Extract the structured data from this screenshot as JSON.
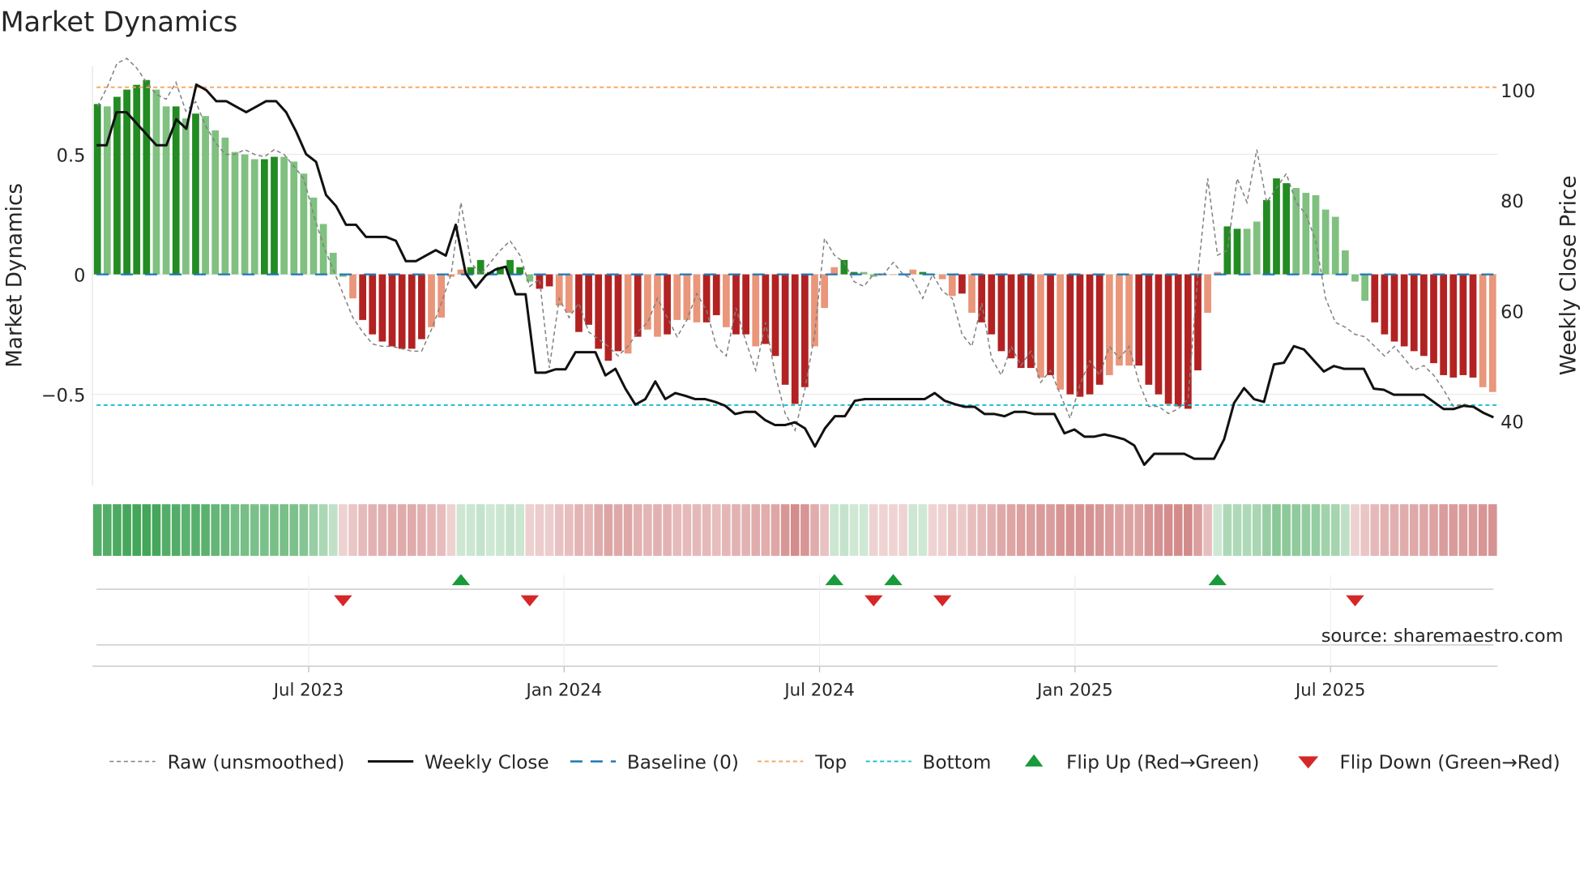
{
  "chart_data": {
    "type": "bar",
    "title": "Market Dynamics",
    "ylabel": "Market Dynamics",
    "y2label": "Weekly Close Price",
    "ylim": [
      -0.88,
      0.88
    ],
    "y2lim": [
      28,
      104.6
    ],
    "yticks": [
      {
        "v": 0.5,
        "label": "0.5"
      },
      {
        "v": 0,
        "label": "0"
      },
      {
        "v": -0.5,
        "label": "−0.5"
      }
    ],
    "y2ticks": [
      {
        "v": 100,
        "label": "100"
      },
      {
        "v": 80,
        "label": "80"
      },
      {
        "v": 60,
        "label": "60"
      },
      {
        "v": 40,
        "label": "40"
      }
    ],
    "xticks": [
      {
        "week": 22,
        "label": "Jul 2023"
      },
      {
        "week": 48,
        "label": "Jan 2024"
      },
      {
        "week": 74,
        "label": "Jul 2024"
      },
      {
        "week": 100,
        "label": "Jan 2025"
      },
      {
        "week": 126,
        "label": "Jul 2025"
      }
    ],
    "top": 0.78,
    "bottom": -0.545,
    "baseline": 0,
    "colors": {
      "G": "#228b22",
      "g": "#80c080",
      "R": "#b22222",
      "r": "#e9967a",
      "raw": "#808080",
      "close": "#111111",
      "baseline": "#1f77b4",
      "top": "#f4a460",
      "bottom": "#17becf",
      "flip_up": "#1a9a3a",
      "flip_down": "#d62728"
    },
    "bars": [
      0.71,
      0.7,
      0.74,
      0.77,
      0.79,
      0.81,
      0.77,
      0.7,
      0.7,
      0.65,
      0.67,
      0.66,
      0.6,
      0.57,
      0.51,
      0.5,
      0.48,
      0.48,
      0.49,
      0.49,
      0.47,
      0.42,
      0.32,
      0.21,
      0.09,
      -0.01,
      -0.1,
      -0.19,
      -0.25,
      -0.28,
      -0.3,
      -0.31,
      -0.31,
      -0.27,
      -0.22,
      -0.18,
      -0.01,
      0.02,
      0.03,
      0.06,
      0.01,
      0.03,
      0.06,
      0.03,
      -0.03,
      -0.06,
      -0.05,
      -0.13,
      -0.16,
      -0.24,
      -0.21,
      -0.31,
      -0.36,
      -0.32,
      -0.33,
      -0.26,
      -0.23,
      -0.26,
      -0.25,
      -0.19,
      -0.19,
      -0.2,
      -0.2,
      -0.17,
      -0.22,
      -0.25,
      -0.25,
      -0.3,
      -0.29,
      -0.34,
      -0.46,
      -0.54,
      -0.47,
      -0.3,
      -0.14,
      0.03,
      0.06,
      0.01,
      0.01,
      -0.01,
      0.0,
      0.0,
      0.0,
      0.02,
      0.01,
      0.0,
      -0.02,
      -0.09,
      -0.08,
      -0.16,
      -0.2,
      -0.25,
      -0.32,
      -0.35,
      -0.39,
      -0.39,
      -0.43,
      -0.42,
      -0.48,
      -0.5,
      -0.51,
      -0.5,
      -0.46,
      -0.42,
      -0.38,
      -0.38,
      -0.38,
      -0.46,
      -0.5,
      -0.54,
      -0.55,
      -0.56,
      -0.4,
      -0.16,
      0.01,
      0.2,
      0.19,
      0.19,
      0.22,
      0.31,
      0.4,
      0.38,
      0.36,
      0.34,
      0.33,
      0.27,
      0.24,
      0.1,
      -0.03,
      -0.11,
      -0.2,
      -0.25,
      -0.28,
      -0.3,
      -0.32,
      -0.34,
      -0.37,
      -0.42,
      -0.43,
      -0.42,
      -0.43,
      -0.47,
      -0.49
    ],
    "bar_shades": "GgGGGGggGgGggggggGGgggggggrRRRRRRRrrrrGGGGGGgRRrrRRRRRrRrrRrrrRRrRRrRRRRRrrrGGggRrrrGgrrRrRRRRRRrRrRRRRrrrRRRRRRRrrGGggGGGggggggggRRRRRRRRRRRrrRRR",
    "raw": [
      0.7,
      0.78,
      0.88,
      0.9,
      0.86,
      0.8,
      0.75,
      0.73,
      0.8,
      0.68,
      0.72,
      0.62,
      0.55,
      0.5,
      0.5,
      0.52,
      0.5,
      0.49,
      0.52,
      0.5,
      0.45,
      0.4,
      0.25,
      0.12,
      0.02,
      -0.08,
      -0.18,
      -0.24,
      -0.29,
      -0.3,
      -0.3,
      -0.31,
      -0.32,
      -0.32,
      -0.23,
      -0.12,
      0.0,
      0.3,
      0.05,
      0.0,
      0.05,
      0.1,
      0.14,
      0.08,
      -0.05,
      -0.02,
      -0.39,
      -0.1,
      -0.18,
      -0.12,
      -0.24,
      -0.27,
      -0.3,
      -0.34,
      -0.3,
      -0.24,
      -0.2,
      -0.1,
      -0.18,
      -0.26,
      -0.19,
      -0.08,
      -0.15,
      -0.3,
      -0.34,
      -0.14,
      -0.28,
      -0.4,
      -0.2,
      -0.42,
      -0.58,
      -0.65,
      -0.48,
      -0.25,
      0.15,
      0.08,
      0.05,
      -0.03,
      -0.05,
      0.0,
      0.0,
      0.05,
      0.0,
      -0.02,
      -0.1,
      0.0,
      -0.07,
      -0.1,
      -0.25,
      -0.3,
      -0.12,
      -0.35,
      -0.42,
      -0.3,
      -0.38,
      -0.32,
      -0.45,
      -0.4,
      -0.5,
      -0.6,
      -0.46,
      -0.36,
      -0.42,
      -0.3,
      -0.35,
      -0.3,
      -0.45,
      -0.55,
      -0.55,
      -0.58,
      -0.56,
      -0.52,
      0.0,
      0.4,
      0.08,
      0.1,
      0.4,
      0.3,
      0.52,
      0.3,
      0.36,
      0.42,
      0.3,
      0.25,
      0.14,
      -0.1,
      -0.2,
      -0.22,
      -0.25,
      -0.26,
      -0.3,
      -0.34,
      -0.3,
      -0.35,
      -0.4,
      -0.38,
      -0.42,
      -0.48,
      -0.55,
      -0.54,
      -0.55
    ],
    "close": [
      90,
      90,
      96,
      96,
      94,
      92,
      90,
      90,
      94.7,
      93,
      101,
      100,
      98,
      98,
      97,
      96,
      97,
      98,
      98,
      96,
      92.5,
      88.4,
      87,
      81,
      79,
      75.6,
      75.6,
      73.4,
      73.4,
      73.4,
      72.7,
      69,
      69,
      70,
      71,
      70,
      75.6,
      66.8,
      64.2,
      66.4,
      67.5,
      68,
      63,
      63,
      48.8,
      48.8,
      49.4,
      49.4,
      52.5,
      52.5,
      52.5,
      48.3,
      49.5,
      45.9,
      43,
      44,
      47.2,
      44,
      45.1,
      44.6,
      44,
      44,
      43.5,
      42.8,
      41.3,
      41.7,
      41.7,
      40.2,
      39.3,
      39.3,
      39.8,
      38.7,
      35.4,
      38.7,
      40.9,
      40.9,
      43.7,
      44,
      44,
      44,
      44,
      44,
      44,
      44,
      45.1,
      43.7,
      43.1,
      42.6,
      42.6,
      41.3,
      41.3,
      40.9,
      41.7,
      41.7,
      41.3,
      41.3,
      41.3,
      37.8,
      38.5,
      37.2,
      37.2,
      37.6,
      37.2,
      36.7,
      35.6,
      32.1,
      34.1,
      34.1,
      34.1,
      34.1,
      33.2,
      33.2,
      33.2,
      36.7,
      43.3,
      46,
      44,
      43.5,
      50.3,
      50.6,
      53.6,
      53,
      51,
      49,
      50,
      49.5,
      49.5,
      49.5,
      45.9,
      45.7,
      44.8,
      44.8,
      44.8,
      44.8,
      43.5,
      42.2,
      42.2,
      42.8,
      42.6,
      41.5,
      40.7
    ],
    "flips_up": [
      37,
      75,
      81,
      114
    ],
    "flips_down": [
      25,
      44,
      79,
      86,
      128
    ],
    "legend": {
      "placement": "bottom",
      "items": [
        {
          "key": "raw",
          "label": "Raw (unsmoothed)"
        },
        {
          "key": "close",
          "label": "Weekly Close"
        },
        {
          "key": "baseline",
          "label": "Baseline (0)"
        },
        {
          "key": "top",
          "label": "Top"
        },
        {
          "key": "bottom",
          "label": "Bottom"
        },
        {
          "key": "flip_up",
          "label": "Flip Up (Red→Green)"
        },
        {
          "key": "flip_down",
          "label": "Flip Down (Green→Red)"
        }
      ]
    },
    "source": "source: sharemaestro.com"
  }
}
